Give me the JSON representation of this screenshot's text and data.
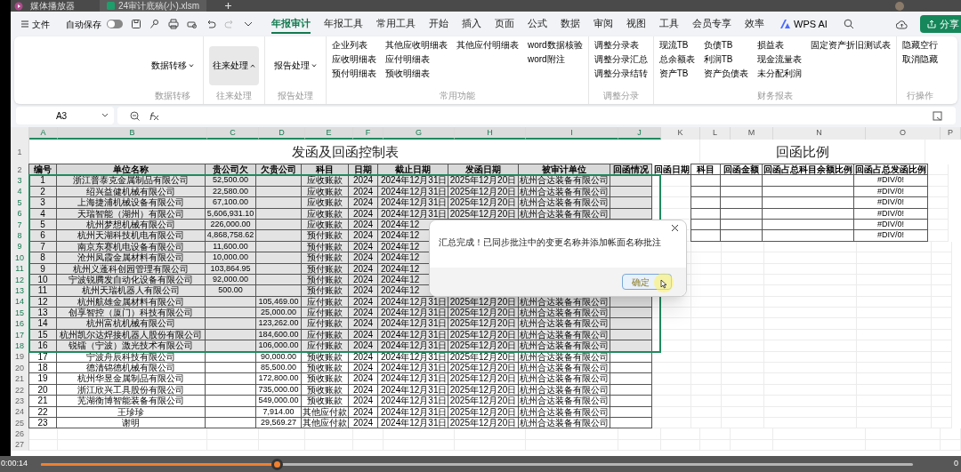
{
  "player": {
    "app_title": "媒体播放器",
    "time": "0:00:14",
    "end_time": "0",
    "level": 0.27
  },
  "title_bar": {
    "file_tab": "24审计底稿(小).xlsm"
  },
  "menu": {
    "file": "文件",
    "autosave": "自动保存",
    "autosave_on": false,
    "tabs": [
      {
        "label": "年报审计",
        "selected": true
      },
      {
        "label": "年报工具",
        "selected": false
      },
      {
        "label": "常用工具",
        "selected": false
      },
      {
        "label": "开始",
        "selected": false
      },
      {
        "label": "插入",
        "selected": false
      },
      {
        "label": "页面",
        "selected": false
      },
      {
        "label": "公式",
        "selected": false
      },
      {
        "label": "数据",
        "selected": false
      },
      {
        "label": "审阅",
        "selected": false
      },
      {
        "label": "视图",
        "selected": false
      },
      {
        "label": "工具",
        "selected": false
      },
      {
        "label": "会员专享",
        "selected": false
      },
      {
        "label": "效率",
        "selected": false
      }
    ],
    "ai": "WPS AI",
    "share": "分享"
  },
  "ribbon": [
    {
      "kind": "dropdown",
      "button": "数据转移",
      "expanded": false,
      "label": "数据转移"
    },
    {
      "kind": "dropdown",
      "button": "往来处理",
      "expanded": true,
      "label": "往来处理"
    },
    {
      "kind": "dropdown",
      "button": "报告处理",
      "expanded": false,
      "label": "报告处理"
    },
    {
      "kind": "list",
      "columns": [
        [
          "企业列表",
          "应收明细表",
          "预付明细表"
        ],
        [
          "其他应收明细表",
          "应付明细表",
          "预收明细表"
        ],
        [
          "其他应付明细表"
        ],
        [
          "word数据核验",
          "word附注"
        ]
      ],
      "label": "常用功能"
    },
    {
      "kind": "list",
      "columns": [
        [
          "调整分录表",
          "调整分录汇总",
          "调整分录结转"
        ]
      ],
      "label": "调整分录"
    },
    {
      "kind": "list",
      "columns": [
        [
          "现流TB",
          "总余额表",
          "资产TB"
        ],
        [
          "负债TB",
          "利润TB",
          "资产负债表"
        ],
        [
          "损益表",
          "现金流量表",
          "未分配利润"
        ],
        [
          "固定资产折旧测试表"
        ]
      ],
      "label": "财务报表"
    },
    {
      "kind": "list",
      "columns": [
        [
          "隐藏空行",
          "取消隐藏"
        ]
      ],
      "label": "行操作"
    }
  ],
  "formula_bar": {
    "cell": "A3"
  },
  "sheet": {
    "columns": [
      {
        "label": "A",
        "selected": true
      },
      {
        "label": "B",
        "selected": true
      },
      {
        "label": "C",
        "selected": true
      },
      {
        "label": "D",
        "selected": true
      },
      {
        "label": "E",
        "selected": true
      },
      {
        "label": "F",
        "selected": true
      },
      {
        "label": "G",
        "selected": true
      },
      {
        "label": "H",
        "selected": true
      },
      {
        "label": "I",
        "selected": true
      },
      {
        "label": "J",
        "selected": true
      },
      {
        "label": "K",
        "selected": false
      },
      {
        "label": "L",
        "selected": false
      },
      {
        "label": "M",
        "selected": false
      },
      {
        "label": "N",
        "selected": false
      },
      {
        "label": "O",
        "selected": false
      },
      {
        "label": "P",
        "selected": false
      }
    ],
    "row_numbers": [
      "1",
      "2",
      "3",
      "4",
      "5",
      "6",
      "7",
      "8",
      "9",
      "10",
      "11",
      "12",
      "13",
      "14",
      "15",
      "16",
      "17",
      "18",
      "19",
      "20",
      "21",
      "22",
      "23",
      "24",
      "25",
      "26",
      "27"
    ],
    "title": "发函及回函控制表",
    "headers": [
      "编号",
      "单位名称",
      "贵公司欠",
      "欠贵公司",
      "科目",
      "日期",
      "截止日期",
      "发函日期",
      "被审计单位",
      "回函情况",
      "回函日期"
    ],
    "rows": [
      {
        "selected": true,
        "no": "1",
        "name": "浙江普泰克金属制品有限公司",
        "owed_by_client": "52,500.00",
        "account": "应收账款",
        "year": "2024",
        "cutoff_date": "2024年12月31日",
        "sent_date": "2025年12月20日",
        "auditee": "杭州合达装备有限公司"
      },
      {
        "selected": true,
        "no": "2",
        "name": "绍兴益健机械有限公司",
        "owed_by_client": "22,580.00",
        "account": "应收账款",
        "year": "2024",
        "cutoff_date": "2024年12月31日",
        "sent_date": "2025年12月20日",
        "auditee": "杭州合达装备有限公司"
      },
      {
        "selected": true,
        "no": "3",
        "name": "上海捷浦机械设备有限公司",
        "owed_by_client": "67,100.00",
        "account": "应收账款",
        "year": "2024",
        "cutoff_date": "2024年12月31日",
        "sent_date": "2025年12月20日",
        "auditee": "杭州合达装备有限公司"
      },
      {
        "selected": true,
        "no": "4",
        "name": "天瑞智能（湖州）有限公司",
        "owed_by_client": "5,606,931.10",
        "account": "应收账款",
        "year": "2024",
        "cutoff_date": "2024年12月31日",
        "sent_date": "2025年12月20日",
        "auditee": "杭州合达装备有限公司"
      },
      {
        "selected": true,
        "no": "5",
        "name": "杭州梦想机械有限公司",
        "owed_by_client": "226,000.00",
        "account": "应收账款",
        "year": "2024",
        "cutoff_date": "2024年12"
      },
      {
        "selected": true,
        "no": "6",
        "name": "杭州天湖科技机电有限公司",
        "owed_by_client": "4,868,758.62",
        "account": "预付账款",
        "year": "2024",
        "cutoff_date": "2024年12"
      },
      {
        "selected": true,
        "no": "7",
        "name": "南京东赛机电设备有限公司",
        "owed_by_client": "11,600.00",
        "account": "预付账款",
        "year": "2024",
        "cutoff_date": "2024年12"
      },
      {
        "selected": true,
        "no": "8",
        "name": "沧州凤霞金属材料有限公司",
        "owed_by_client": "10,000.00",
        "account": "预付账款",
        "year": "2024",
        "cutoff_date": "2024年12"
      },
      {
        "selected": true,
        "no": "9",
        "name": "杭州义蓬科创园管理有限公司",
        "owed_by_client": "103,864.95",
        "account": "预付账款",
        "year": "2024",
        "cutoff_date": "2024年12"
      },
      {
        "selected": true,
        "no": "10",
        "name": "宁波锐腾发自动化设备有限公司",
        "owed_by_client": "92,000.00",
        "account": "预付账款",
        "year": "2024",
        "cutoff_date": "2024年12"
      },
      {
        "selected": true,
        "no": "11",
        "name": "杭州天瑞机器人有限公司",
        "owed_by_client": "500.00",
        "account": "预付账款",
        "year": "2024",
        "cutoff_date": "2024年12"
      },
      {
        "selected": true,
        "no": "12",
        "name": "杭州航雄金属材料有限公司",
        "owed_to_client": "105,469.00",
        "account": "应付账款",
        "year": "2024",
        "cutoff_date": "2024年12月31日",
        "sent_date": "2025年12月20日",
        "auditee": "杭州合达装备有限公司"
      },
      {
        "selected": true,
        "no": "13",
        "name": "创享智控（厦门）科技有限公司",
        "owed_to_client": "25,000.00",
        "account": "应付账款",
        "year": "2024",
        "cutoff_date": "2024年12月31日",
        "sent_date": "2025年12月20日",
        "auditee": "杭州合达装备有限公司"
      },
      {
        "selected": true,
        "no": "14",
        "name": "杭州富杭机械有限公司",
        "owed_to_client": "123,262.00",
        "account": "应付账款",
        "year": "2024",
        "cutoff_date": "2024年12月31日",
        "sent_date": "2025年12月20日",
        "auditee": "杭州合达装备有限公司"
      },
      {
        "selected": true,
        "no": "15",
        "name": "杭州凯尔达焊接机器人股份有限公司",
        "owed_to_client": "184,600.00",
        "account": "应付账款",
        "year": "2024",
        "cutoff_date": "2024年12月31日",
        "sent_date": "2025年12月20日",
        "auditee": "杭州合达装备有限公司"
      },
      {
        "selected": true,
        "no": "16",
        "name": "锐镭（宁波）激光技术有限公司",
        "owed_to_client": "106,000.00",
        "account": "应付账款",
        "year": "2024",
        "cutoff_date": "2024年12月31日",
        "sent_date": "2025年12月20日",
        "auditee": "杭州合达装备有限公司"
      },
      {
        "selected": false,
        "no": "17",
        "name": "宁波舟辰科技有限公司",
        "owed_to_client": "90,000.00",
        "account": "预收账款",
        "year": "2024",
        "cutoff_date": "2024年12月31日",
        "sent_date": "2025年12月20日",
        "auditee": "杭州合达装备有限公司"
      },
      {
        "selected": false,
        "no": "18",
        "name": "德清锦德机械有限公司",
        "owed_to_client": "85,500.00",
        "account": "预收账款",
        "year": "2024",
        "cutoff_date": "2024年12月31日",
        "sent_date": "2025年12月20日",
        "auditee": "杭州合达装备有限公司"
      },
      {
        "selected": false,
        "no": "19",
        "name": "杭州华昱金属制品有限公司",
        "owed_to_client": "172,800.00",
        "account": "预收账款",
        "year": "2024",
        "cutoff_date": "2024年12月31日",
        "sent_date": "2025年12月20日",
        "auditee": "杭州合达装备有限公司"
      },
      {
        "selected": false,
        "no": "20",
        "name": "浙江欣兴工具股份有限公司",
        "owed_to_client": "735,000.00",
        "account": "预收账款",
        "year": "2024",
        "cutoff_date": "2024年12月31日",
        "sent_date": "2025年12月20日",
        "auditee": "杭州合达装备有限公司"
      },
      {
        "selected": false,
        "no": "21",
        "name": "芜湖衡博智能装备有限公司",
        "owed_to_client": "549,000.00",
        "account": "预收账款",
        "year": "2024",
        "cutoff_date": "2024年12月31日",
        "sent_date": "2025年12月20日",
        "auditee": "杭州合达装备有限公司"
      },
      {
        "selected": false,
        "no": "22",
        "name": "王珍珍",
        "owed_to_client": "7,914.00",
        "account": "其他应付款",
        "year": "2024",
        "cutoff_date": "2024年12月31日",
        "sent_date": "2025年12月20日",
        "auditee": "杭州合达装备有限公司"
      },
      {
        "selected": false,
        "no": "23",
        "name": "谢明",
        "owed_to_client": "29,569.27",
        "account": "其他应付款",
        "year": "2024",
        "cutoff_date": "2024年12月31日",
        "sent_date": "2025年12月20日",
        "auditee": "杭州合达装备有限公司"
      }
    ],
    "ratio": {
      "title": "回函比例",
      "headers": [
        "科目",
        "回函金额",
        "回函占总科目余额比例",
        "回函占总发函比例"
      ],
      "rows": [
        {
          "ratio_total": "#DIV/0!"
        },
        {
          "ratio_total": "#DIV/0!"
        },
        {
          "ratio_total": "#DIV/0!"
        },
        {
          "ratio_total": "#DIV/0!"
        },
        {
          "ratio_total": "#DIV/0!"
        },
        {
          "ratio_total": "#DIV/0!"
        }
      ]
    }
  },
  "dialog": {
    "message": "汇总完成！已同步批注中的变更名称并添加帐面名称批注",
    "button": "确定"
  }
}
